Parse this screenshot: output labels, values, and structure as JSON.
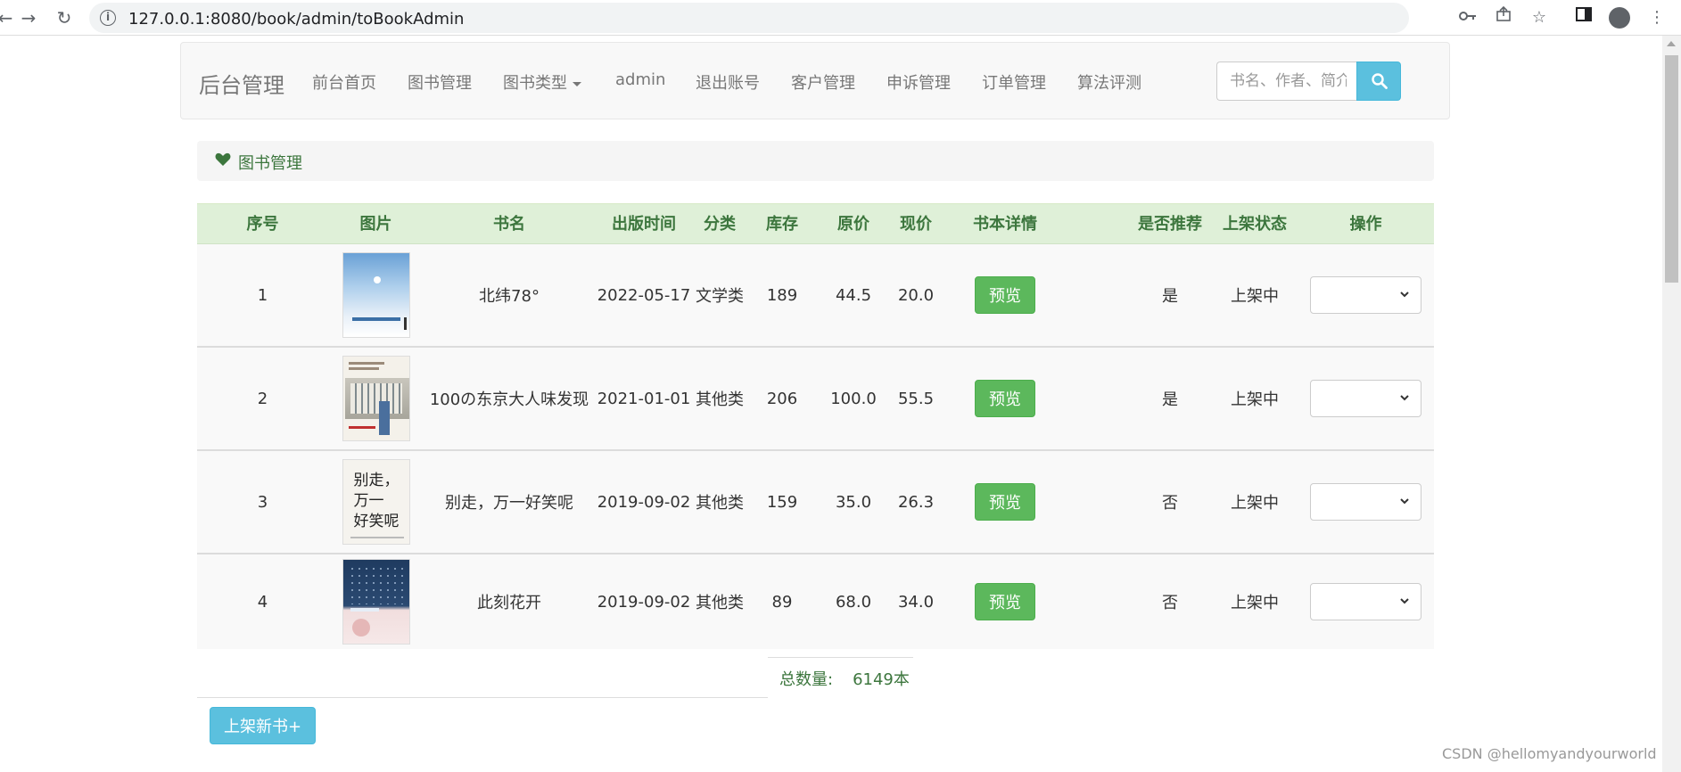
{
  "browser": {
    "url": "127.0.0.1:8080/book/admin/toBookAdmin"
  },
  "navbar": {
    "brand": "后台管理",
    "items": [
      "前台首页",
      "图书管理",
      "图书类型",
      "admin",
      "退出账号",
      "客户管理",
      "申诉管理",
      "订单管理",
      "算法评测"
    ],
    "search_placeholder": "书名、作者、简介"
  },
  "panel": {
    "title": "图书管理"
  },
  "table": {
    "headers": [
      "序号",
      "图片",
      "书名",
      "出版时间",
      "分类",
      "库存",
      "原价",
      "现价",
      "书本详情",
      "是否推荐",
      "上架状态",
      "操作"
    ],
    "rows": [
      {
        "index": "1",
        "name": "北纬78°",
        "date": "2022-05-17",
        "category": "文学类",
        "stock": "189",
        "orig_price": "44.5",
        "price": "20.0",
        "detail_btn": "预览",
        "recommend": "是",
        "status": "上架中"
      },
      {
        "index": "2",
        "name": "100の东京大人味发现",
        "date": "2021-01-01",
        "category": "其他类",
        "stock": "206",
        "orig_price": "100.0",
        "price": "55.5",
        "detail_btn": "预览",
        "recommend": "是",
        "status": "上架中"
      },
      {
        "index": "3",
        "name": "别走，万一好笑呢",
        "date": "2019-09-02",
        "category": "其他类",
        "stock": "159",
        "orig_price": "35.0",
        "price": "26.3",
        "detail_btn": "预览",
        "recommend": "否",
        "status": "上架中"
      },
      {
        "index": "4",
        "name": "此刻花开",
        "date": "2019-09-02",
        "category": "其他类",
        "stock": "89",
        "orig_price": "68.0",
        "price": "34.0",
        "detail_btn": "预览",
        "recommend": "否",
        "status": "上架中"
      }
    ],
    "cover3_text": [
      "别走，",
      "万一",
      "好笑呢"
    ]
  },
  "footer": {
    "total_label": "总数量:",
    "total_value": "6149本",
    "add_button": "上架新书+"
  },
  "watermark": "CSDN @hellomyandyourworld",
  "colors": {
    "header_green": "#dff0d8",
    "text_green": "#3c763d",
    "preview_btn": "#5cb85c",
    "info_btn": "#5bc0de"
  }
}
